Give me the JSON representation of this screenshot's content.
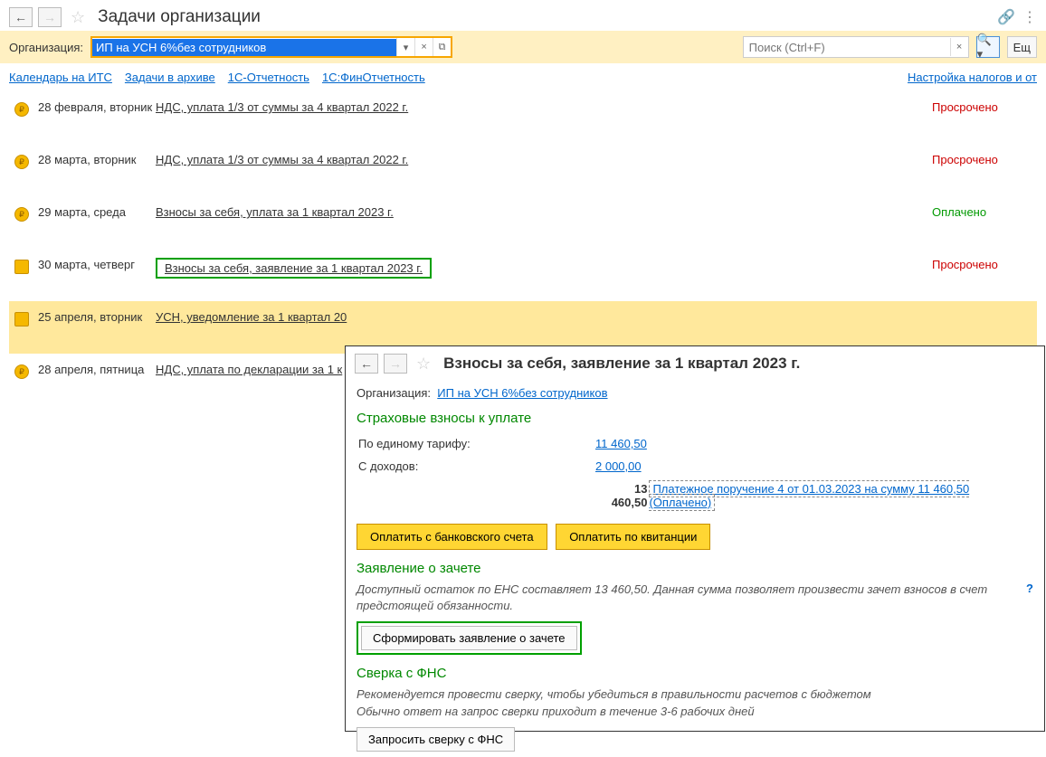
{
  "header": {
    "title": "Задачи организации"
  },
  "filter": {
    "org_label": "Организация:",
    "org_value": "ИП на УСН 6%без сотрудников",
    "search_placeholder": "Поиск (Ctrl+F)",
    "more_label": "Ещ"
  },
  "links": {
    "its": "Календарь на ИТС",
    "archive": "Задачи в архиве",
    "rep1c": "1С-Отчетность",
    "finrep": "1С:ФинОтчетность",
    "tax_settings": "Настройка налогов и от"
  },
  "tasks": [
    {
      "date": "28 февраля, вторник",
      "title": "НДС, уплата 1/3 от суммы за 4 квартал 2022 г.",
      "status_text": "Просрочено",
      "status": "overdue"
    },
    {
      "date": "28 марта, вторник",
      "title": "НДС, уплата 1/3 от суммы за 4 квартал 2022 г.",
      "status_text": "Просрочено",
      "status": "overdue"
    },
    {
      "date": "29 марта, среда",
      "title": "Взносы за себя, уплата за 1 квартал 2023 г.",
      "status_text": "Оплачено",
      "status": "paid"
    },
    {
      "date": "30 марта, четверг",
      "title": "Взносы за себя, заявление за 1 квартал 2023 г.",
      "status_text": "Просрочено",
      "status": "overdue",
      "framed": true,
      "env": true
    },
    {
      "date": "25 апреля, вторник",
      "title": "УСН, уведомление за 1 квартал 20",
      "status_text": "",
      "status": "",
      "selected": true,
      "env": true
    },
    {
      "date": "28 апреля, пятница",
      "title": "НДС, уплата по декларации за 1 к",
      "status_text": "",
      "status": ""
    }
  ],
  "popup": {
    "title": "Взносы за себя, заявление за 1 квартал 2023 г.",
    "org_label": "Организация:",
    "org_link": "ИП на УСН 6%без сотрудников",
    "section_insurance": "Страховые взносы к уплате",
    "row_tariff_label": "По единому тарифу:",
    "row_tariff_val": "11 460,50",
    "row_income_label": "С доходов:",
    "row_income_val": "2 000,00",
    "total": "13 460,50",
    "pay_doc": "Платежное поручение 4 от 01.03.2023 на сумму 11 460,50 (Оплачено)",
    "btn_bank": "Оплатить с банковского счета",
    "btn_receipt": "Оплатить по квитанции",
    "section_offset": "Заявление о зачете",
    "offset_hint": "Доступный остаток по ЕНС составляет 13 460,50. Данная сумма позволяет произвести зачет взносов в счет предстоящей обязанности.",
    "btn_form": "Сформировать заявление о зачете",
    "section_fns": "Сверка с ФНС",
    "fns_hint1": "Рекомендуется провести сверку, чтобы убедиться в правильности расчетов с бюджетом",
    "fns_hint2": "Обычно ответ на запрос сверки приходит в течение 3-6 рабочих дней",
    "btn_fns": "Запросить сверку с ФНС",
    "help": "?"
  }
}
